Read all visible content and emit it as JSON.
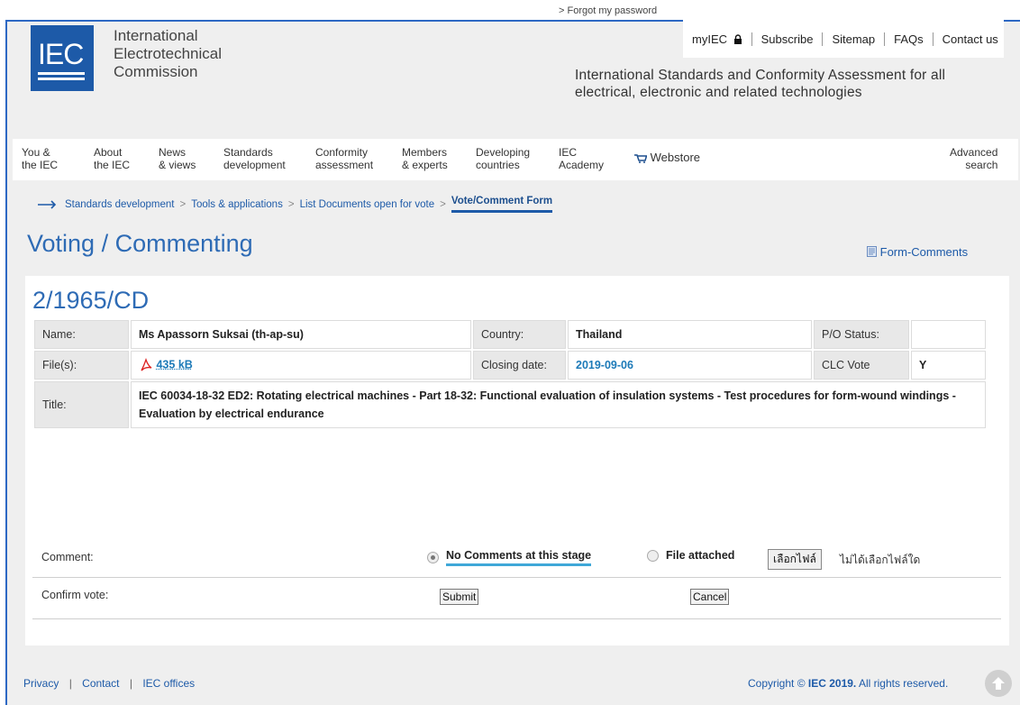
{
  "header": {
    "logo_text": "IEC",
    "org_name": [
      "International",
      "Electrotechnical",
      "Commission"
    ],
    "forgot_password": "> Forgot my password",
    "top_links": [
      "myIEC",
      "Subscribe",
      "Sitemap",
      "FAQs",
      "Contact us"
    ],
    "tagline": [
      "International Standards and Conformity Assessment for all",
      "electrical, electronic and related technologies"
    ]
  },
  "nav": {
    "items": [
      {
        "l1": "You &",
        "l2": "the IEC"
      },
      {
        "l1": "About",
        "l2": "the IEC"
      },
      {
        "l1": "News",
        "l2": "& views"
      },
      {
        "l1": "Standards",
        "l2": "development"
      },
      {
        "l1": "Conformity",
        "l2": "assessment"
      },
      {
        "l1": "Members",
        "l2": "& experts"
      },
      {
        "l1": "Developing",
        "l2": "countries"
      },
      {
        "l1": "IEC",
        "l2": "Academy"
      }
    ],
    "webstore": "Webstore",
    "advanced": {
      "l1": "Advanced",
      "l2": "search"
    }
  },
  "breadcrumb": {
    "items": [
      "Standards development",
      "Tools & applications",
      "List Documents open for vote"
    ],
    "current": "Vote/Comment Form"
  },
  "page": {
    "title": "Voting / Commenting",
    "form_comments": "Form-Comments",
    "doc_id": "2/1965/CD"
  },
  "info": {
    "name_label": "Name:",
    "name_value": "Ms Apassorn Suksai (th-ap-su)",
    "country_label": "Country:",
    "country_value": "Thailand",
    "po_label": "P/O Status:",
    "po_value": "",
    "files_label": "File(s):",
    "file_size": "435 kB",
    "closing_label": "Closing date:",
    "closing_value": "2019-09-06",
    "clc_label": "CLC Vote",
    "clc_value": "Y",
    "title_label": "Title:",
    "title_value": "IEC 60034-18-32 ED2: Rotating electrical machines - Part 18-32: Functional evaluation of insulation systems - Test procedures for form-wound windings - Evaluation by electrical endurance"
  },
  "form": {
    "comment_label": "Comment:",
    "option_none": "No Comments at this stage",
    "option_file": "File attached",
    "file_button": "เลือกไฟล์",
    "no_file": "ไม่ได้เลือกไฟล์ใด",
    "confirm_label": "Confirm vote:",
    "submit": "Submit",
    "cancel": "Cancel"
  },
  "footer": {
    "links": [
      "Privacy",
      "Contact",
      "IEC offices"
    ],
    "copyright_pre": "Copyright ©",
    "copyright_org": "IEC 2019.",
    "copyright_post": "All rights reserved."
  }
}
